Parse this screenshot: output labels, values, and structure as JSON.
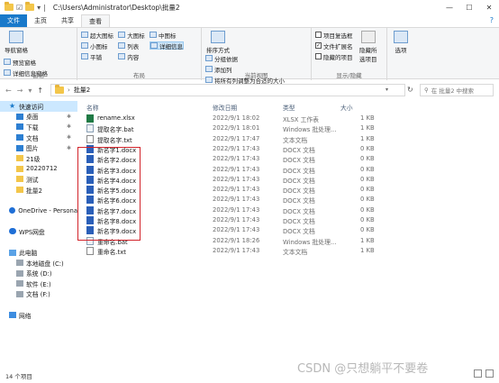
{
  "window": {
    "path": "C:\\Users\\Administrator\\Desktop\\批量2",
    "controls": [
      "—",
      "☐",
      "✕"
    ]
  },
  "tabs": [
    "文件",
    "主页",
    "共享",
    "查看"
  ],
  "ribbon": {
    "pane_group": {
      "nav_pane": "导航窗格",
      "preview_pane": "预览窗格",
      "details_pane": "详细信息窗格",
      "label": "窗格"
    },
    "layout_group": {
      "items": [
        "超大图标",
        "大图标",
        "中图标",
        "小图标",
        "列表",
        "详细信息",
        "平铺",
        "内容"
      ],
      "label": "布局"
    },
    "current_view_group": {
      "sort": "排序方式",
      "group_by": "分组依据",
      "add_col": "添加列",
      "fit_cols": "将所有列调整为合适的大小",
      "label": "当前视图"
    },
    "show_hide_group": {
      "item_checkbox": "项目复选框",
      "file_ext": "文件扩展名",
      "hidden_items": "隐藏的项目",
      "hide_selected": "隐藏所选项目",
      "options": "选项",
      "label": "显示/隐藏",
      "item_checkbox_checked": false,
      "file_ext_checked": true,
      "hidden_items_checked": false
    }
  },
  "address": {
    "folder": "批量2",
    "search_placeholder": "在 批量2 中搜索"
  },
  "nav_pane": {
    "items": [
      {
        "label": "快速访问",
        "icon": "star-icon",
        "level": 0,
        "active": true
      },
      {
        "label": "桌面",
        "icon": "desktop-icon",
        "level": 1,
        "pinned": true
      },
      {
        "label": "下载",
        "icon": "download-icon",
        "level": 1,
        "pinned": true
      },
      {
        "label": "文档",
        "icon": "document-icon",
        "level": 1,
        "pinned": true
      },
      {
        "label": "图片",
        "icon": "picture-icon",
        "level": 1,
        "pinned": true
      },
      {
        "label": "21级",
        "icon": "folder-icon",
        "level": 1
      },
      {
        "label": "20220712",
        "icon": "folder-icon",
        "level": 1
      },
      {
        "label": "测试",
        "icon": "folder-icon",
        "level": 1
      },
      {
        "label": "批量2",
        "icon": "folder-icon",
        "level": 1
      },
      {
        "label": "",
        "icon": "",
        "level": 0,
        "spacer": true
      },
      {
        "label": "OneDrive - Persona",
        "icon": "onedrive-icon",
        "level": 0
      },
      {
        "label": "",
        "icon": "",
        "level": 0,
        "spacer": true
      },
      {
        "label": "WPS网盘",
        "icon": "cloud-drive-icon",
        "level": 0
      },
      {
        "label": "",
        "icon": "",
        "level": 0,
        "spacer": true
      },
      {
        "label": "此电脑",
        "icon": "computer-icon",
        "level": 0
      },
      {
        "label": "本地磁盘 (C:)",
        "icon": "drive-icon",
        "level": 1
      },
      {
        "label": "系统 (D:)",
        "icon": "drive-icon",
        "level": 1
      },
      {
        "label": "软件 (E:)",
        "icon": "drive-icon",
        "level": 1
      },
      {
        "label": "文档 (F:)",
        "icon": "drive-icon",
        "level": 1
      },
      {
        "label": "",
        "icon": "",
        "level": 0,
        "spacer": true
      },
      {
        "label": "网络",
        "icon": "network-icon",
        "level": 0
      }
    ]
  },
  "columns": [
    "名称",
    "修改日期",
    "类型",
    "大小"
  ],
  "files": [
    {
      "name": "rename.xlsx",
      "date": "2022/9/1 18:02",
      "type": "XLSX 工作表",
      "size": "1 KB",
      "kind": "xlsx"
    },
    {
      "name": "提取名字.bat",
      "date": "2022/9/1 18:01",
      "type": "Windows 批处理...",
      "size": "1 KB",
      "kind": "bat"
    },
    {
      "name": "提取名字.txt",
      "date": "2022/9/1 17:47",
      "type": "文本文档",
      "size": "1 KB",
      "kind": "txt"
    },
    {
      "name": "新名字1.docx",
      "date": "2022/9/1 17:43",
      "type": "DOCX 文档",
      "size": "0 KB",
      "kind": "docx"
    },
    {
      "name": "新名字2.docx",
      "date": "2022/9/1 17:43",
      "type": "DOCX 文档",
      "size": "0 KB",
      "kind": "docx"
    },
    {
      "name": "新名字3.docx",
      "date": "2022/9/1 17:43",
      "type": "DOCX 文档",
      "size": "0 KB",
      "kind": "docx"
    },
    {
      "name": "新名字4.docx",
      "date": "2022/9/1 17:43",
      "type": "DOCX 文档",
      "size": "0 KB",
      "kind": "docx"
    },
    {
      "name": "新名字5.docx",
      "date": "2022/9/1 17:43",
      "type": "DOCX 文档",
      "size": "0 KB",
      "kind": "docx"
    },
    {
      "name": "新名字6.docx",
      "date": "2022/9/1 17:43",
      "type": "DOCX 文档",
      "size": "0 KB",
      "kind": "docx"
    },
    {
      "name": "新名字7.docx",
      "date": "2022/9/1 17:43",
      "type": "DOCX 文档",
      "size": "0 KB",
      "kind": "docx"
    },
    {
      "name": "新名字8.docx",
      "date": "2022/9/1 17:43",
      "type": "DOCX 文档",
      "size": "0 KB",
      "kind": "docx"
    },
    {
      "name": "新名字9.docx",
      "date": "2022/9/1 17:43",
      "type": "DOCX 文档",
      "size": "0 KB",
      "kind": "docx"
    },
    {
      "name": "重命名.bat",
      "date": "2022/9/1 18:26",
      "type": "Windows 批处理...",
      "size": "1 KB",
      "kind": "bat"
    },
    {
      "name": "重命名.txt",
      "date": "2022/9/1 17:43",
      "type": "文本文档",
      "size": "1 KB",
      "kind": "txt"
    }
  ],
  "status": {
    "count": "14 个项目"
  },
  "watermark": "CSDN @只想躺平不要卷",
  "colors": {
    "accent": "#1979ca",
    "highlight_box": "#d2232a"
  }
}
